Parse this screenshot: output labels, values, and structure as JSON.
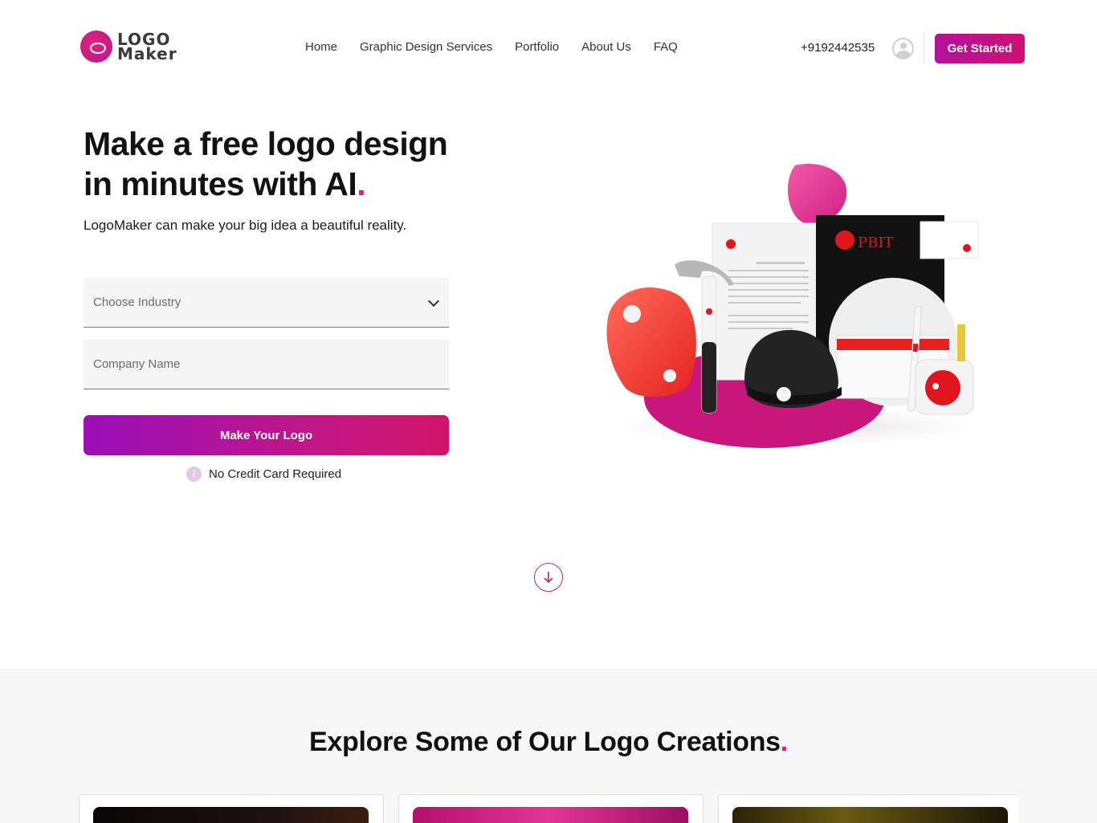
{
  "header": {
    "logo_line1": "LOGO",
    "logo_line2": "Maker",
    "nav": [
      "Home",
      "Graphic Design Services",
      "Portfolio",
      "About Us",
      "FAQ"
    ],
    "phone": "+9192442535",
    "cta_label": "Get Started"
  },
  "hero": {
    "title_line1": "Make a free logo design",
    "title_line2": "in minutes with AI",
    "title_dot": ".",
    "subtitle": "LogoMaker can make your big idea a beautiful reality.",
    "industry_placeholder": "Choose Industry",
    "company_placeholder": "Company Name",
    "button_label": "Make Your Logo",
    "note": "No Credit Card Required",
    "info_icon": "i"
  },
  "illustration": {
    "brand": "PBIT"
  },
  "explore": {
    "title": "Explore Some of Our Logo Creations",
    "title_dot": "."
  },
  "colors": {
    "accent": "#d6247f",
    "brand_gradient_start": "#9a0fb8",
    "brand_gradient_end": "#d11468"
  }
}
